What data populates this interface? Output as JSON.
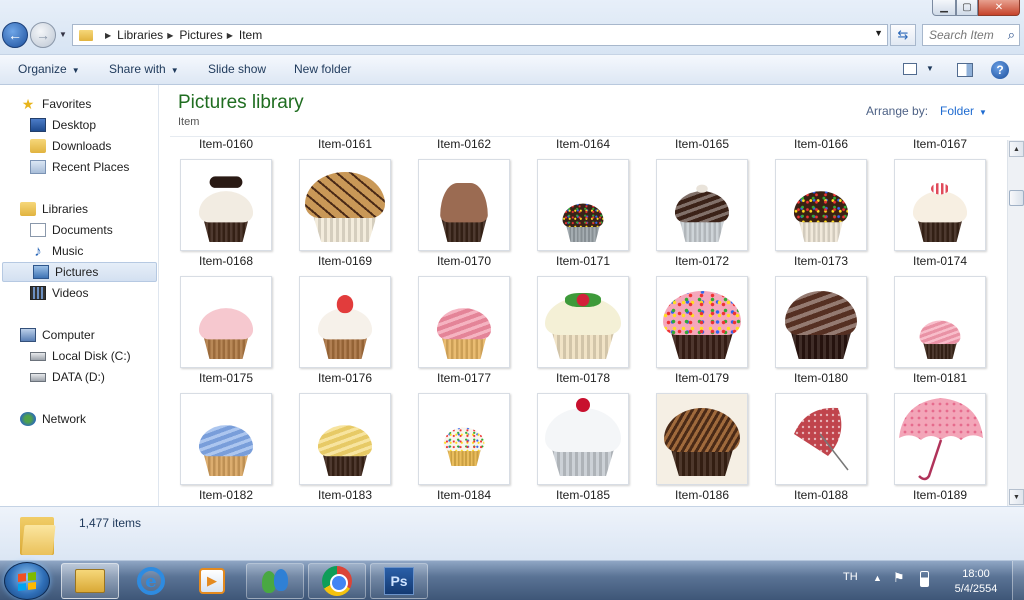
{
  "window": {
    "breadcrumb": [
      "Libraries",
      "Pictures",
      "Item"
    ],
    "search_placeholder": "Search Item",
    "controls": {
      "minimize": "▁",
      "maximize": "▢",
      "close": "✕"
    }
  },
  "toolbar": {
    "organize": "Organize",
    "share_with": "Share with",
    "slide_show": "Slide show",
    "new_folder": "New folder",
    "help": "?"
  },
  "nav": {
    "favorites": "Favorites",
    "desktop": "Desktop",
    "downloads": "Downloads",
    "recent_places": "Recent Places",
    "libraries": "Libraries",
    "documents": "Documents",
    "music": "Music",
    "pictures": "Pictures",
    "videos": "Videos",
    "computer": "Computer",
    "local_disk": "Local Disk (C:)",
    "data_disk": "DATA (D:)",
    "network": "Network"
  },
  "library": {
    "title": "Pictures library",
    "subtitle": "Item",
    "arrange_label": "Arrange by:",
    "arrange_value": "Folder"
  },
  "top_row_labels": [
    "Item-0160",
    "Item-0161",
    "Item-0162",
    "Item-0164",
    "Item-0165",
    "Item-0166",
    "Item-0167"
  ],
  "rows": [
    [
      {
        "label": "Item-0168",
        "thumb": "cupcake-vanilla-cookie"
      },
      {
        "label": "Item-0169",
        "thumb": "cupcake-caramel-chocolate-sticks"
      },
      {
        "label": "Item-0170",
        "thumb": "cupcake-chocolate-kisses"
      },
      {
        "label": "Item-0171",
        "thumb": "cupcake-chocolate-sprinkles-small"
      },
      {
        "label": "Item-0172",
        "thumb": "cupcake-chocolate-swirl"
      },
      {
        "label": "Item-0173",
        "thumb": "cupcake-chocolate-rainbow-sprinkles"
      },
      {
        "label": "Item-0174",
        "thumb": "cupcake-cream-candy"
      }
    ],
    [
      {
        "label": "Item-0175",
        "thumb": "cupcake-pink-frosting"
      },
      {
        "label": "Item-0176",
        "thumb": "cupcake-white-strawberry"
      },
      {
        "label": "Item-0177",
        "thumb": "cupcake-pink-swirl"
      },
      {
        "label": "Item-0178",
        "thumb": "cupcake-holly"
      },
      {
        "label": "Item-0179",
        "thumb": "cupcake-pink-sprinkles-chocolate"
      },
      {
        "label": "Item-0180",
        "thumb": "cupcake-chocolate-swirl-dark"
      },
      {
        "label": "Item-0181",
        "thumb": "cupcake-pink-rose"
      }
    ],
    [
      {
        "label": "Item-0182",
        "thumb": "cupcake-blue-swirl"
      },
      {
        "label": "Item-0183",
        "thumb": "cupcake-yellow-swirl"
      },
      {
        "label": "Item-0184",
        "thumb": "cupcake-mini-sprinkles"
      },
      {
        "label": "Item-0185",
        "thumb": "cupcake-white-cherry"
      },
      {
        "label": "Item-0186",
        "thumb": "cupcake-chocolate-shavings"
      },
      {
        "label": "Item-0188",
        "thumb": "umbrella-red-pattern"
      },
      {
        "label": "Item-0189",
        "thumb": "umbrella-pink-floral"
      }
    ]
  ],
  "details": {
    "count": "1,477 items"
  },
  "taskbar": {
    "lang": "TH",
    "time": "18:00",
    "date": "5/4/2554",
    "ps_label": "Ps"
  }
}
